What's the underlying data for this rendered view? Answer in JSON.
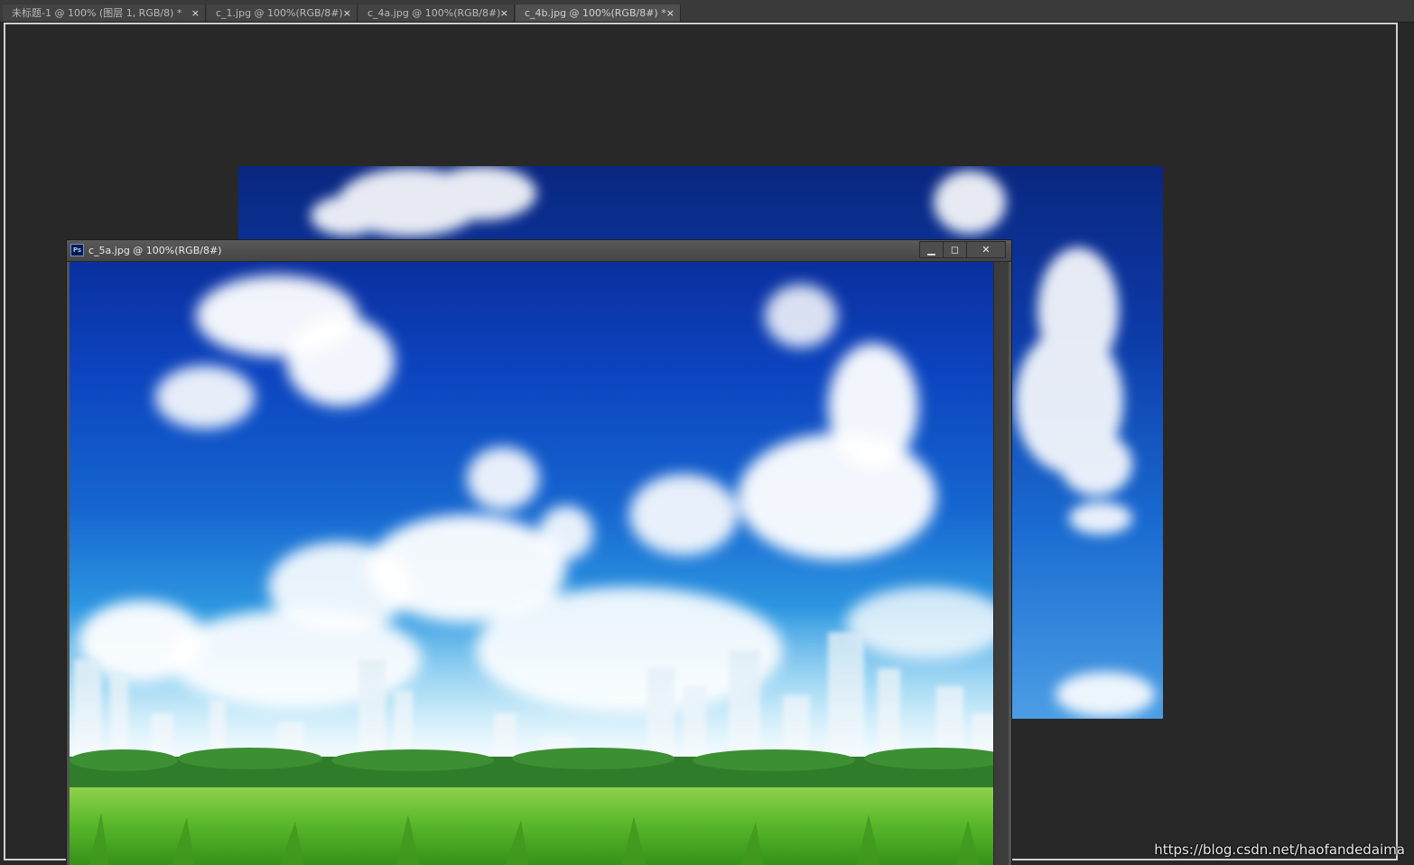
{
  "tabs": [
    {
      "label": "未标题-1 @ 100% (图层 1, RGB/8) *",
      "close": "×"
    },
    {
      "label": "c_1.jpg @ 100%(RGB/8#)",
      "close": "×"
    },
    {
      "label": "c_4a.jpg @ 100%(RGB/8#)",
      "close": "×"
    },
    {
      "label": "c_4b.jpg @ 100%(RGB/8#) *",
      "close": "×"
    }
  ],
  "floating_window": {
    "app_badge": "Ps",
    "title": "c_5a.jpg @ 100%(RGB/8#)",
    "minimize": "▁",
    "maximize": "◻",
    "close": "✕"
  },
  "images": {
    "back": "sky-with-clouds",
    "front": "sky-city-skyline-grass"
  },
  "watermark": "https://blog.csdn.net/haofandedaima",
  "colors": {
    "workspace": "#282828",
    "tab_bg": "#434343",
    "window_chrome": "#535353",
    "sky_top": "#0a2f9e",
    "grass": "#4fb02a"
  }
}
